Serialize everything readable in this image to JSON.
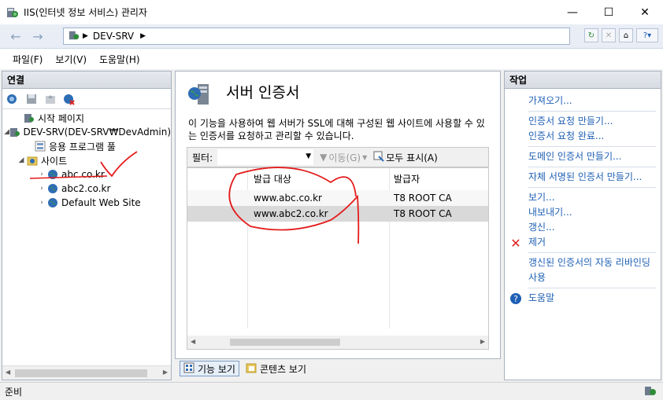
{
  "window": {
    "title": "IIS(인터넷 정보 서비스) 관리자"
  },
  "address": {
    "path": "DEV-SRV"
  },
  "menus": [
    "파일(F)",
    "보기(V)",
    "도움말(H)"
  ],
  "connections": {
    "header": "연결",
    "tree": [
      {
        "label": "시작 페이지"
      },
      {
        "label": "DEV-SRV(DEV-SRV₩DevAdmin)"
      },
      {
        "label": "응용 프로그램 풀"
      },
      {
        "label": "사이트"
      },
      {
        "label": "abc.co.kr"
      },
      {
        "label": "abc2.co.kr"
      },
      {
        "label": "Default Web Site"
      }
    ]
  },
  "center": {
    "title": "서버 인증서",
    "description": "이 기능을 사용하여 웹 서버가 SSL에 대해 구성된 웹 사이트에 사용할 수 있는 인증서를 요청하고 관리할 수 있습니다.",
    "filter_label": "필터:",
    "go_label": "이동(G)",
    "show_all_label": "모두 표시(A)",
    "columns": [
      "발급 대상",
      "발급자"
    ],
    "rows": [
      {
        "issued_to": "www.abc.co.kr",
        "issuer": "T8 ROOT CA"
      },
      {
        "issued_to": "www.abc2.co.kr",
        "issuer": "T8 ROOT CA"
      }
    ]
  },
  "view_tabs": [
    "기능 보기",
    "콘텐츠 보기"
  ],
  "actions": {
    "header": "작업",
    "groups": [
      [
        "가져오기..."
      ],
      [
        "인증서 요청 만들기...",
        "인증서 요청 완료..."
      ],
      [
        "도메인 인증서 만들기..."
      ],
      [
        "자체 서명된 인증서 만들기..."
      ],
      [
        "보기...",
        "내보내기...",
        "갱신...",
        "제거"
      ],
      [
        "갱신된 인증서의 자동 리바인딩 사용"
      ],
      [
        "도움말"
      ]
    ]
  },
  "status": {
    "text": "준비"
  },
  "colors": {
    "link": "#1e5fb4",
    "annotation": "#e41b1b",
    "selected_row": "#d9d9d9"
  }
}
